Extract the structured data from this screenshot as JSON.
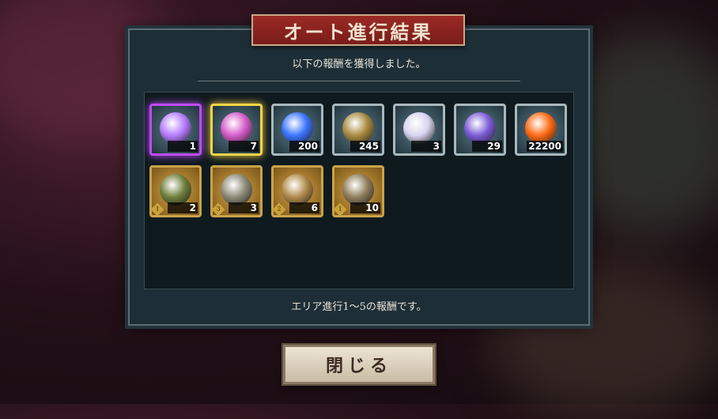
{
  "dialog": {
    "title": "オート進行結果",
    "subtitle": "以下の報酬を獲得しました。",
    "footer": "エリア進行1～5の報酬です。",
    "close_label": "閉じる"
  },
  "rewards_row1": [
    {
      "name": "rainbow-flower-crystal-icon",
      "count": "1",
      "frame": "#c04aff",
      "art": "#b57cff"
    },
    {
      "name": "gold-flower-crystal-icon",
      "count": "7",
      "frame": "#f6d547",
      "art": "#d55cc9"
    },
    {
      "name": "blue-orb-icon",
      "count": "200",
      "frame": "#a9b8bd",
      "art": "#3a74ff"
    },
    {
      "name": "bronze-coin-icon",
      "count": "245",
      "frame": "#a9b8bd",
      "art": "#a9893f"
    },
    {
      "name": "silver-dice-icon",
      "count": "3",
      "frame": "#a9b8bd",
      "art": "#d9d4ef"
    },
    {
      "name": "purple-crystal-icon",
      "count": "29",
      "frame": "#a9b8bd",
      "art": "#7b5bd6"
    },
    {
      "name": "flame-orb-icon",
      "count": "22200",
      "frame": "#a9b8bd",
      "art": "#ff6a12"
    }
  ],
  "rewards_row2": [
    {
      "name": "censer-icon",
      "count": "2",
      "level": "1",
      "frame": "#c9a34a",
      "art": "#6f7f3b"
    },
    {
      "name": "mirror-icon",
      "count": "3",
      "level": "3",
      "frame": "#c9a34a",
      "art": "#8c8a76"
    },
    {
      "name": "bell-icon",
      "count": "6",
      "level": "2",
      "frame": "#c9a34a",
      "art": "#b08a4a"
    },
    {
      "name": "bracelet-icon",
      "count": "10",
      "level": "1",
      "frame": "#c9a34a",
      "art": "#8f7d5b"
    }
  ]
}
